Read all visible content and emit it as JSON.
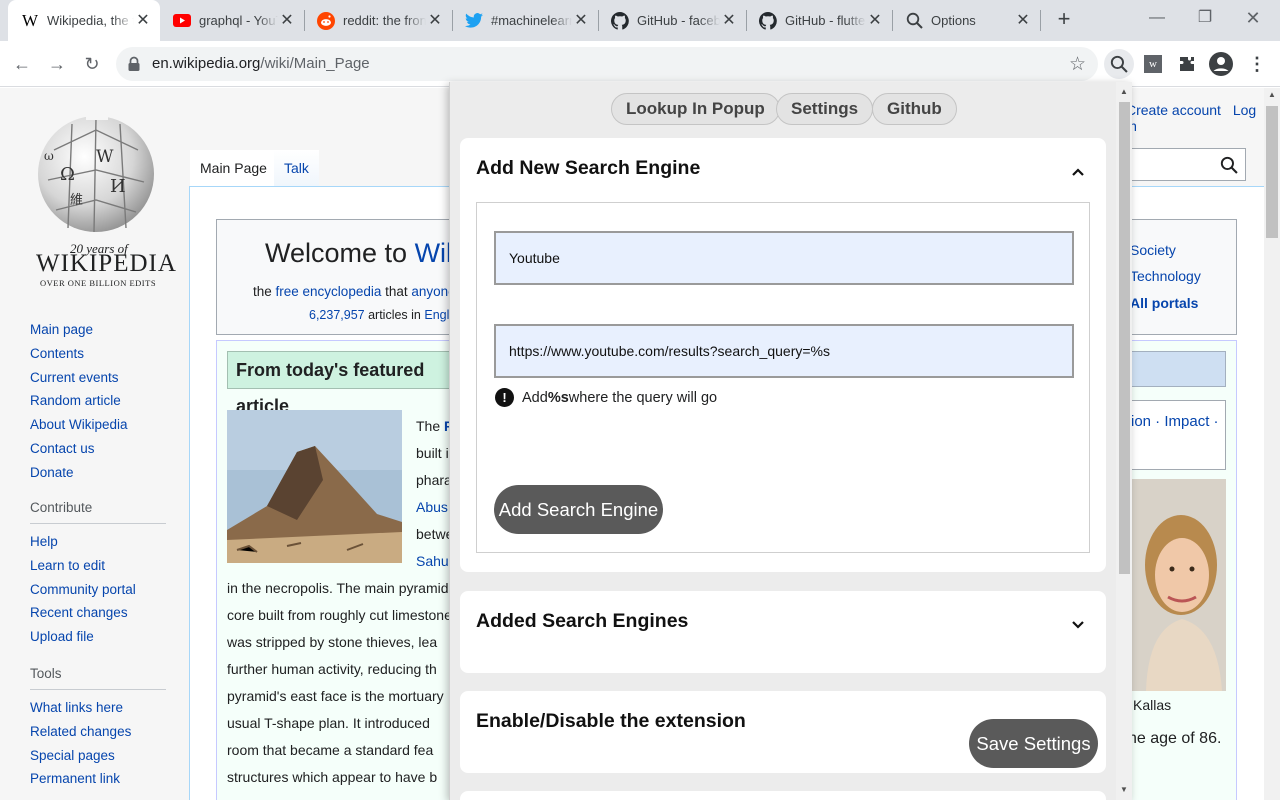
{
  "browser": {
    "tabs": [
      {
        "title": "Wikipedia, the free encyclopedia",
        "favicon": "wikipedia-w-icon",
        "active": true
      },
      {
        "title": "graphql - YouTube",
        "favicon": "youtube-icon",
        "active": false
      },
      {
        "title": "reddit: the front page of the internet",
        "favicon": "reddit-icon",
        "active": false
      },
      {
        "title": "#machinelearning",
        "favicon": "twitter-icon",
        "active": false
      },
      {
        "title": "GitHub - facebook",
        "favicon": "github-icon",
        "active": false
      },
      {
        "title": "GitHub - flutter",
        "favicon": "github-icon",
        "active": false
      },
      {
        "title": "Options",
        "favicon": "search-icon",
        "active": false
      }
    ],
    "url_host": "en.wikipedia.org",
    "url_path": "/wiki/Main_Page"
  },
  "wiki": {
    "logo": {
      "tagline_1": "20 years of",
      "wordmark": "WIKIPEDIA",
      "tagline_2": "OVER ONE BILLION EDITS"
    },
    "nav_links": [
      "Main page",
      "Contents",
      "Current events",
      "Random article",
      "About Wikipedia",
      "Contact us",
      "Donate"
    ],
    "contribute": {
      "heading": "Contribute",
      "links": [
        "Help",
        "Learn to edit",
        "Community portal",
        "Recent changes",
        "Upload file"
      ]
    },
    "tools": {
      "heading": "Tools",
      "links": [
        "What links here",
        "Related changes",
        "Special pages",
        "Permanent link"
      ]
    },
    "page_tabs": [
      "Main Page",
      "Talk"
    ],
    "top_links": [
      "Create account",
      "Log in"
    ],
    "welcome": {
      "prefix": "Welcome to ",
      "link": "Wikipedia",
      "line2_a": "the ",
      "line2_link1": "free encyclopedia",
      "line2_b": " that ",
      "line2_link2": "anyone can edit",
      "count": "6,237,957",
      "count_suffix": " articles in ",
      "lang": "English"
    },
    "featured": {
      "heading": "From today's featured article",
      "right_fragments": [
        "The ",
        "built i",
        "phara",
        "Abus",
        "betwe",
        "Sahu"
      ],
      "lines": [
        "in the necropolis. The main pyramid",
        "core built from roughly cut limestone",
        "was stripped by stone thieves, lea",
        "further human activity, reducing th",
        "pyramid's east face is the mortuary",
        "usual T-shape plan. It introduced",
        "room that became a standard fea",
        "structures which appear to have b"
      ]
    },
    "right_column": {
      "portal_links": [
        "Society",
        "Technology",
        "All portals"
      ],
      "news_links": "ion · Impact ·",
      "caption": "Kallas",
      "age_text": "he age of 86."
    }
  },
  "popup": {
    "nav_buttons": [
      "Lookup In Popup",
      "Settings",
      "Github"
    ],
    "add_section": {
      "title": "Add New Search Engine",
      "name_value": "Youtube",
      "url_value": "https://www.youtube.com/results?search_query=%s",
      "hint_prefix": "Add ",
      "hint_code": "%s",
      "hint_suffix": " where the query will go",
      "button": "Add Search Engine"
    },
    "added_section": {
      "title": "Added Search Engines"
    },
    "toggle_section": {
      "title": "Enable/Disable the extension"
    },
    "save_button": "Save Settings"
  }
}
